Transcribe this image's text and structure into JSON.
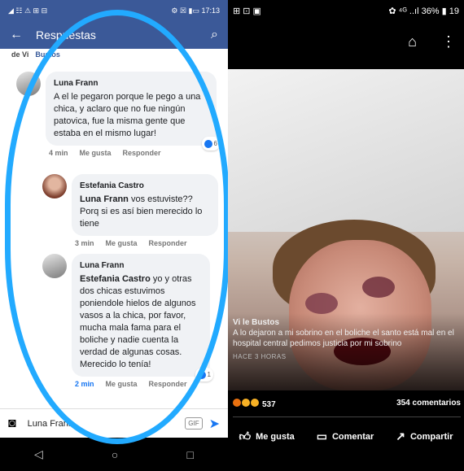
{
  "left": {
    "status": {
      "carrier": "◢ ☷ ⚠ ⊞ ⊟",
      "battery": "⚙ ☒ ▮▭ 17:13"
    },
    "appbar": {
      "title": "Respuestas"
    },
    "sub": {
      "prefix": "de Vi",
      "link": "Bustos"
    },
    "comments": [
      {
        "name": "Luna Frann",
        "mention": "",
        "text": "A el le pegaron porque le pego a una chica, y aclaro que no fue ningún patovica, fue la misma gente que estaba en el mismo lugar!",
        "time": "4 min",
        "like": "Me gusta",
        "reply": "Responder",
        "reactions": "6"
      },
      {
        "name": "Estefania Castro",
        "mention": "Luna Frann",
        "text": " vos estuviste?? Porq si es así bien merecido lo tiene",
        "time": "3 min",
        "like": "Me gusta",
        "reply": "Responder",
        "reactions": ""
      },
      {
        "name": "Luna Frann",
        "mention": "Estefania Castro",
        "text": " yo y otras dos chicas estuvimos poniendole hielos de algunos vasos a la chica, por favor, mucha mala fama para el boliche y nadie cuenta la verdad de algunas cosas. Merecido lo tenía!",
        "time": "2 min",
        "like": "Me gusta",
        "reply": "Responder",
        "reactions": "1"
      }
    ],
    "input": {
      "value": "Luna Frann",
      "gif": "GIF"
    }
  },
  "right": {
    "status": {
      "left": "⊞ ⊡ ▣",
      "right": "✿ ⁴ᴳ ..ıl 36% ▮ 19"
    },
    "caption": {
      "author": "Vi le Bustos",
      "text": "A lo dejaron a mi sobrino en el boliche el santo está mal en el hospital central pedimos justicia por mi sobrino",
      "ago": "HACE 3 HORAS"
    },
    "stats": {
      "reactions": "537",
      "comments": "354 comentarios"
    },
    "actions": {
      "like": "Me gusta",
      "comment": "Comentar",
      "share": "Compartir"
    }
  }
}
